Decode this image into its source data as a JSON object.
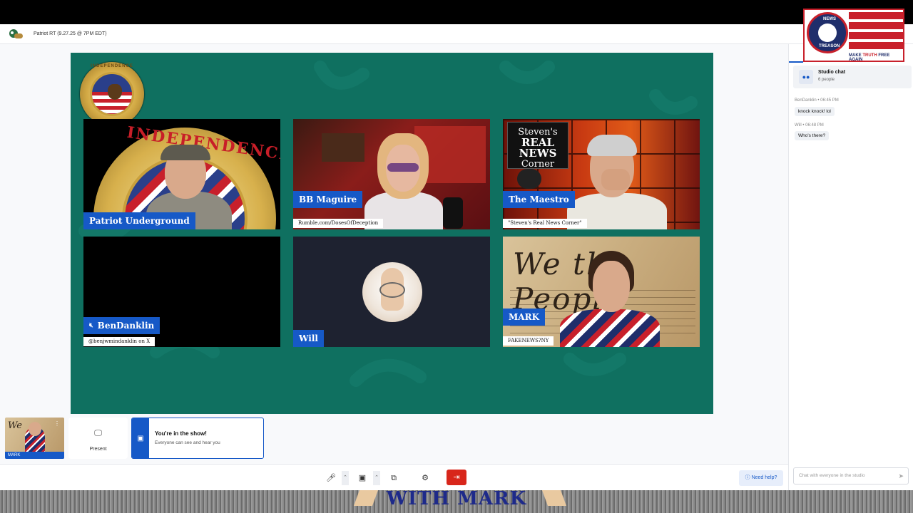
{
  "header": {
    "title": "Patriot RT (9.27.25 @ 7PM EDT)"
  },
  "overlay_logo": {
    "top_word": "NEWS",
    "bottom_word": "TREASON",
    "tagline_pre": "MAKE ",
    "tagline_em": "TRUTH",
    "tagline_post": " FREE AGAIN"
  },
  "participants": [
    {
      "name": "Patriot Underground",
      "subtitle": "",
      "muted": false,
      "tile_words": "INDEPENDENCE"
    },
    {
      "name": "BB Maguire",
      "subtitle": "Rumble.com/DosesOfDeception",
      "muted": false
    },
    {
      "name": "The Maestro",
      "subtitle": "\"Steven's Real News Corner\"",
      "muted": false,
      "sign": {
        "l1": "Steven's",
        "l2": "REAL NEWS",
        "l3": "Corner"
      }
    },
    {
      "name": "BenDanklin",
      "subtitle": "@benjwmindanklin on X",
      "muted": true
    },
    {
      "name": "Will",
      "subtitle": "",
      "muted": false
    },
    {
      "name": "MARK",
      "subtitle": "FAKENEWS?NY",
      "muted": false,
      "tile_words": "We the People"
    }
  ],
  "self_preview": {
    "name": "MARK"
  },
  "present": {
    "label": "Present"
  },
  "show_banner": {
    "title": "You're in the show!",
    "subtitle": "Everyone can see and hear you"
  },
  "toolbar": {
    "help_label": "Need help?"
  },
  "chat": {
    "title": "Studio chat",
    "people_count": "6 people",
    "messages": [
      {
        "author": "BenDanklin",
        "time": "06:45 PM",
        "text": "knock knock! lol"
      },
      {
        "author": "Will",
        "time": "06:48 PM",
        "text": "Who's there?"
      }
    ],
    "input_placeholder": "Chat with everyone in the studio"
  },
  "bottom_banner": {
    "text": "WITH MARK"
  },
  "colors": {
    "stage": "#0f7060",
    "nameplate": "#1659c7",
    "leave": "#d8261b"
  }
}
